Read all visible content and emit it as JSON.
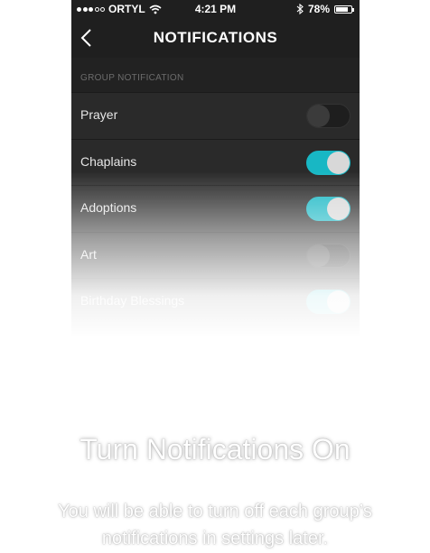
{
  "status_bar": {
    "carrier": "ORTYL",
    "time": "4:21 PM",
    "battery": "78%",
    "icons": [
      "signal-dots-icon",
      "wifi-icon",
      "bluetooth-icon",
      "battery-icon"
    ]
  },
  "nav": {
    "title": "NOTIFICATIONS",
    "back_icon": "chevron-left-icon"
  },
  "section": {
    "header": "GROUP NOTIFICATION"
  },
  "rows": [
    {
      "label": "Prayer",
      "on": false
    },
    {
      "label": "Chaplains",
      "on": true
    },
    {
      "label": "Adoptions",
      "on": true
    },
    {
      "label": "Art",
      "on": false
    },
    {
      "label": "Birthday Blessings",
      "on": true
    }
  ],
  "onboarding": {
    "headline": "Turn Notifications On",
    "subtext_line1": "You will be able to turn off each group’s",
    "subtext_line2": "notifications in settings later."
  },
  "colors": {
    "toggle_on": "#18b7c4",
    "background_dark": "#232323"
  }
}
